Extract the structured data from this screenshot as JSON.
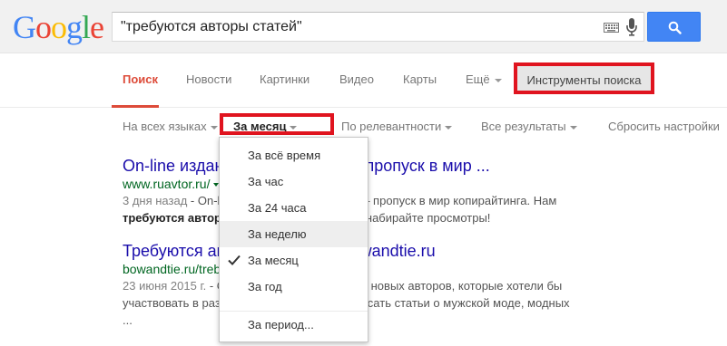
{
  "header": {
    "logo_letters": [
      {
        "char": "G",
        "color": "#4285f4"
      },
      {
        "char": "o",
        "color": "#ea4335"
      },
      {
        "char": "o",
        "color": "#fbbc05"
      },
      {
        "char": "g",
        "color": "#4285f4"
      },
      {
        "char": "l",
        "color": "#34a853"
      },
      {
        "char": "e",
        "color": "#ea4335"
      }
    ],
    "search_value": "\"требуются авторы статей\"",
    "icons": {
      "keyboard": "keyboard-icon",
      "mic": "microphone-icon",
      "search": "search-icon"
    },
    "search_button_color": "#4285f4"
  },
  "tabs": {
    "items": [
      "Поиск",
      "Новости",
      "Картинки",
      "Видео",
      "Карты",
      "Ещё"
    ],
    "active": "Поиск",
    "tools_label": "Инструменты поиска",
    "active_color": "#dd4b39"
  },
  "toolbar": {
    "language": "На всех языках",
    "period": "За месяц",
    "sort": "По релевантности",
    "results": "Все результаты",
    "reset": "Сбросить настройки"
  },
  "results": [
    {
      "title": "On-line издание «Ruavtor.ru» — пропуск в мир ...",
      "url": "www.ruavtor.ru/",
      "date": "3 дня назад",
      "snippet_pre": " - On-line издание «Ruavtor.ru» — пропуск в мир копирайтинга. Нам ",
      "snippet_bold": "требуются авторы",
      "snippet_post": " статей. Пишите статьи, набирайте просмотры!"
    },
    {
      "title": "Требуются авторы статей — bowandtie.ru",
      "url": "bowandtie.ru/trebuyutsya-avtory-statey/",
      "date": "23 июня 2015 г.",
      "snippet_pre": " - Сейчас мы заняты поиском новых авторов, которые хотели бы участвовать в развитии нашего проекта и писать статьи о мужской моде, модных ...",
      "snippet_bold": "",
      "snippet_post": ""
    }
  ],
  "dropdown": {
    "items": [
      "За всё время",
      "За час",
      "За 24 часа",
      "За неделю",
      "За месяц",
      "За год"
    ],
    "hovered": "За неделю",
    "checked": "За месяц",
    "custom": "За период..."
  },
  "highlight_color": "#e0141f"
}
